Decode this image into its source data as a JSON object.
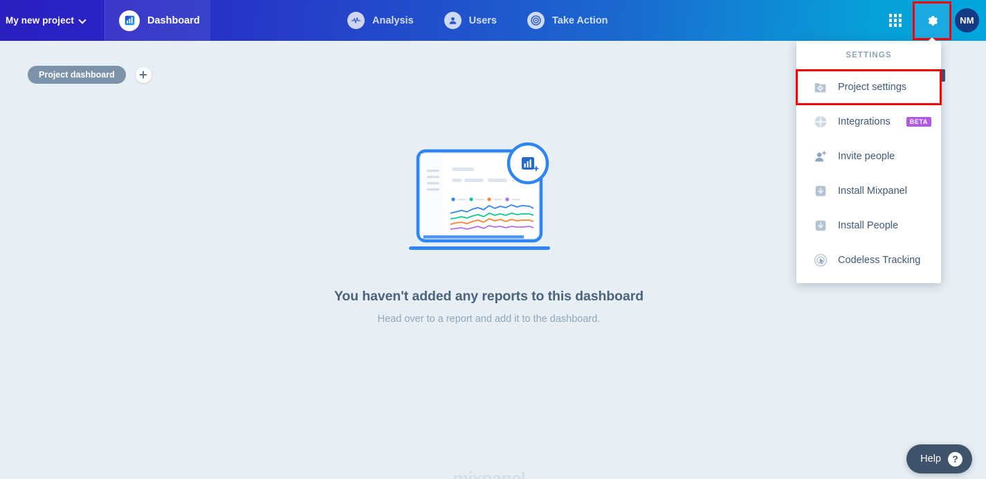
{
  "header": {
    "project_name": "My new project",
    "project_chevron_icon": "chevron-down-icon",
    "nav": [
      {
        "label": "Dashboard",
        "icon": "bar-chart-icon",
        "active": true
      },
      {
        "label": "Analysis",
        "icon": "pulse-icon",
        "active": false
      },
      {
        "label": "Users",
        "icon": "person-icon",
        "active": false
      },
      {
        "label": "Take Action",
        "icon": "target-icon",
        "active": false
      }
    ],
    "apps_icon": "apps-grid-icon",
    "settings_icon": "gear-icon",
    "avatar_initials": "NM",
    "accent_gradient_from": "#2a1fc0",
    "accent_gradient_to": "#00a7dc",
    "gear_active_bg": "#1aa9e0",
    "highlight_color": "#fc0000"
  },
  "dashboard_tabs": {
    "active_tab": "Project dashboard",
    "add_tab_icon": "plus-icon",
    "pill_color": "#7d93aa"
  },
  "empty_state": {
    "title": "You haven't added any reports to this dashboard",
    "subtitle": "Head over to a report and add it to the dashboard.",
    "illustration_icon": "add-report-illustration"
  },
  "illustration": {
    "legend_dot_colors": [
      "#2f86f0",
      "#10c98a",
      "#fa8334",
      "#b36ce8"
    ],
    "line_colors": [
      "#2f86f0",
      "#10c98a",
      "#fa8334",
      "#b36ce8"
    ],
    "badge_icon": "add-chart-icon",
    "frame_color": "#2f86f0"
  },
  "watermark": {
    "text": "mixpanel",
    "color": "#d2e0ea"
  },
  "help": {
    "label": "Help",
    "icon": "question-mark-icon",
    "bg": "#3f546b"
  },
  "settings_menu": {
    "header": "SETTINGS",
    "items": [
      {
        "label": "Project settings",
        "icon": "folder-gear-icon",
        "highlighted": true,
        "badge": ""
      },
      {
        "label": "Integrations",
        "icon": "integrations-icon",
        "highlighted": false,
        "badge": "BETA"
      },
      {
        "label": "Invite people",
        "icon": "person-add-icon",
        "highlighted": false,
        "badge": ""
      },
      {
        "label": "Install Mixpanel",
        "icon": "download-icon",
        "highlighted": false,
        "badge": ""
      },
      {
        "label": "Install People",
        "icon": "download-icon",
        "highlighted": false,
        "badge": ""
      },
      {
        "label": "Codeless Tracking",
        "icon": "codeless-cursor-icon",
        "highlighted": false,
        "badge": ""
      }
    ],
    "badge_color": "#b05ae8"
  }
}
